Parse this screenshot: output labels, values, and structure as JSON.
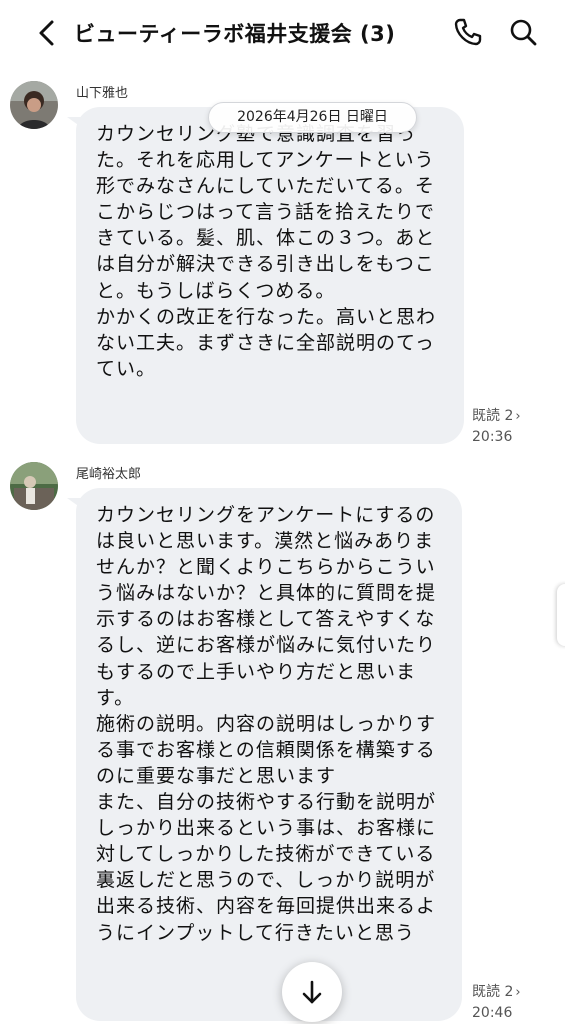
{
  "header": {
    "title": "ビューティーラボ福井支援会 (3)",
    "back_icon": "chevron-left-icon",
    "phone_icon": "phone-icon",
    "search_icon": "search-icon"
  },
  "date_separator": "2026年4月26日 日曜日",
  "messages": [
    {
      "sender": "山下雅也",
      "text": "カウンセリング塾で意識調査を習った。それを応用してアンケートという形でみなさんにしていただいてる。そこからじつはって言う話を拾えたりできている。髪、肌、体この３つ。あとは自分が解決できる引き出しをもつこと。もうしばらくつめる。\nかかくの改正を行なった。高いと思わない工夫。まずさきに全部説明のてってい。",
      "read": "既読 2",
      "time": "20:36"
    },
    {
      "sender": "尾崎裕太郎",
      "text": "カウンセリングをアンケートにするのは良いと思います。漠然と悩みありませんか？と聞くよりこちらからこういう悩みはないか？と具体的に質問を提示するのはお客様として答えやすくなるし、逆にお客様が悩みに気付いたりもするので上手いやり方だと思います。\n施術の説明。内容の説明はしっかりする事でお客様との信頼関係を構築するのに重要な事だと思います\nまた、自分の技術やする行動を説明がしっかり出来るという事は、お客様に対してしっかりした技術ができている裏返しだと思うので、しっかり説明が出来る技術、内容を毎回提供出来るようにインプットして行きたいと思う",
      "read": "既読 2",
      "time": "20:46"
    }
  ],
  "scroll_down_icon": "arrow-down-icon",
  "colors": {
    "bubble": "#eef0f3",
    "background": "#ffffff",
    "text": "#111111"
  }
}
